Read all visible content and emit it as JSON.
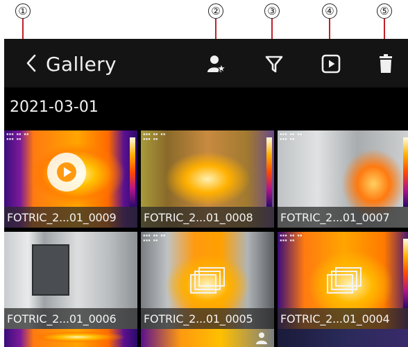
{
  "callouts": [
    "①",
    "②",
    "③",
    "④",
    "⑤"
  ],
  "appbar": {
    "title": "Gallery",
    "icons": [
      "back-chevron-icon",
      "person-star-icon",
      "filter-icon",
      "video-play-icon",
      "trash-icon"
    ]
  },
  "date_group": "2021-03-01",
  "thumbnails": [
    {
      "name": "FOTRIC_2...01_0009",
      "kind": "video",
      "selected": true
    },
    {
      "name": "FOTRIC_2...01_0008",
      "kind": "image",
      "selected": false
    },
    {
      "name": "FOTRIC_2...01_0007",
      "kind": "image",
      "selected": false
    },
    {
      "name": "FOTRIC_2...01_0006",
      "kind": "visible-image",
      "selected": false
    },
    {
      "name": "FOTRIC_2...01_0005",
      "kind": "sequence",
      "selected": false
    },
    {
      "name": "FOTRIC_2...01_0004",
      "kind": "sequence",
      "selected": false
    }
  ],
  "colors": {
    "appbar_bg": "#141414",
    "page_bg": "#000000",
    "selection": "#2a7fe0",
    "callout_line": "#c0202a"
  }
}
